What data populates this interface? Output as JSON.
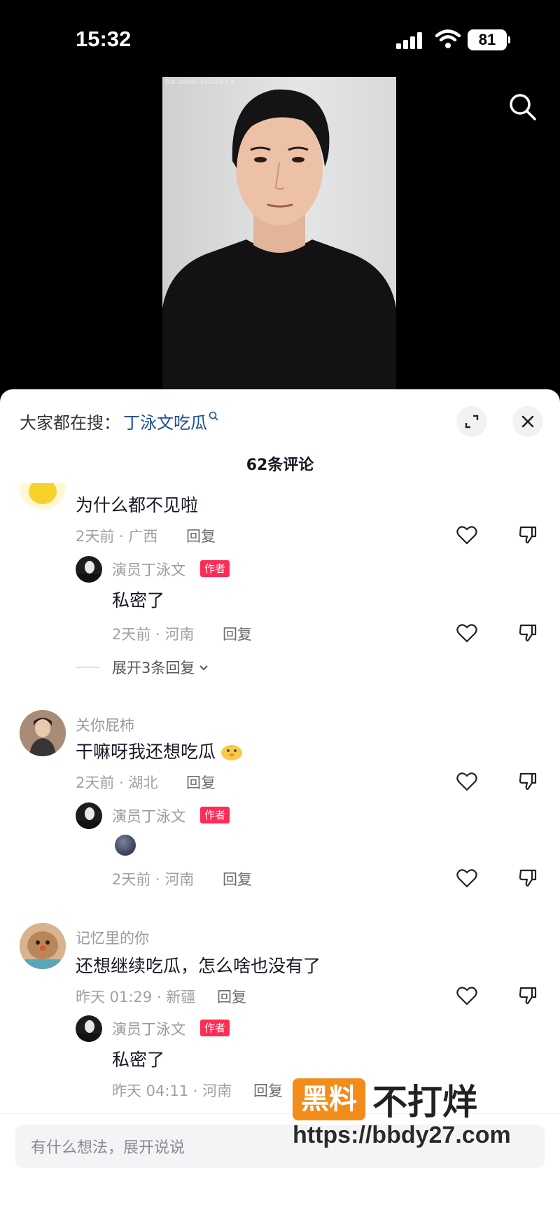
{
  "status_bar": {
    "time": "15:32",
    "battery": "81"
  },
  "video": {
    "watermark": "DJI OSMO POCKET 3"
  },
  "panel": {
    "search_prefix": "大家都在搜：",
    "search_keyword": "丁泳文吃瓜",
    "comment_count": "62条评论"
  },
  "comments": [
    {
      "username": "",
      "text": "为什么都不见啦",
      "meta": "2天前 · 广西",
      "reply_label": "回复",
      "author_reply": {
        "username": "演员丁泳文",
        "badge": "作者",
        "text": "私密了",
        "meta": "2天前 · 河南",
        "reply_label": "回复"
      },
      "expand_label": "展开3条回复"
    },
    {
      "username": "关你屁柿",
      "text": "干嘛呀我还想吃瓜",
      "meta": "2天前 · 湖北",
      "reply_label": "回复",
      "author_reply": {
        "username": "演员丁泳文",
        "badge": "作者",
        "text": "",
        "meta": "2天前 · 河南",
        "reply_label": "回复"
      }
    },
    {
      "username": "记忆里的你",
      "text": "还想继续吃瓜，怎么啥也没有了",
      "meta": "昨天 01:29 · 新疆",
      "reply_label": "回复",
      "author_reply": {
        "username": "演员丁泳文",
        "badge": "作者",
        "text": "私密了",
        "meta": "昨天 04:11 · 河南",
        "reply_label": "回复"
      }
    }
  ],
  "input": {
    "placeholder": "有什么想法，展开说说"
  },
  "site_watermark": {
    "badge": "黑料",
    "rest": "不打烊",
    "url": "https://bbdy27.com"
  },
  "colors": {
    "accent": "#fe2c55",
    "keyword": "#1f4e8c",
    "site_orange": "#f28c1a"
  }
}
